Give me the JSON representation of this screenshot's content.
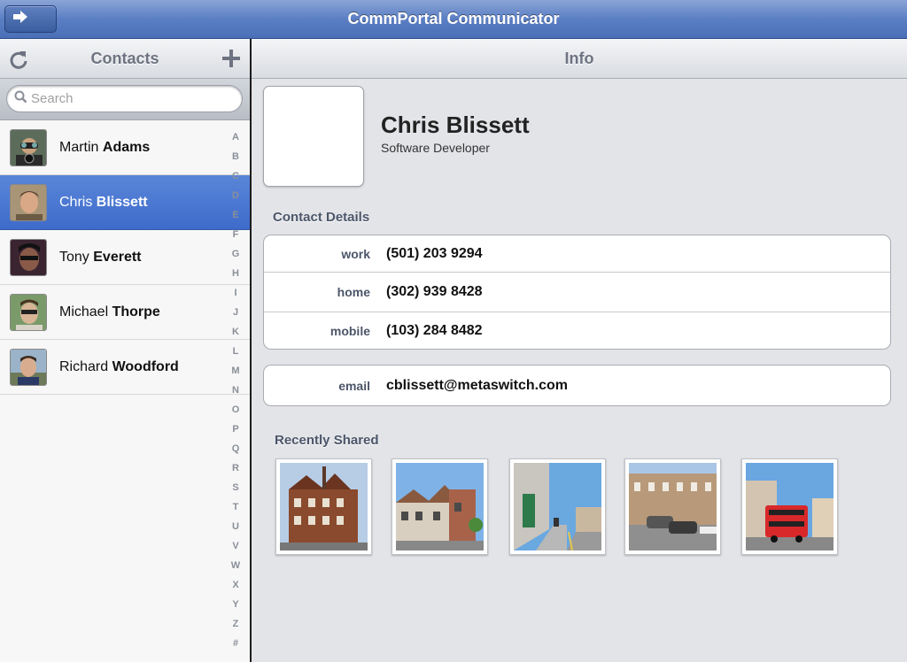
{
  "app": {
    "title": "CommPortal Communicator"
  },
  "left": {
    "header": "Contacts",
    "search_placeholder": "Search",
    "contacts": [
      {
        "first": "Martin",
        "last": "Adams",
        "selected": false
      },
      {
        "first": "Chris",
        "last": "Blissett",
        "selected": true
      },
      {
        "first": "Tony",
        "last": "Everett",
        "selected": false
      },
      {
        "first": "Michael",
        "last": "Thorpe",
        "selected": false
      },
      {
        "first": "Richard",
        "last": "Woodford",
        "selected": false
      }
    ],
    "index": [
      "A",
      "B",
      "C",
      "D",
      "E",
      "F",
      "G",
      "H",
      "I",
      "J",
      "K",
      "L",
      "M",
      "N",
      "O",
      "P",
      "Q",
      "R",
      "S",
      "T",
      "U",
      "V",
      "W",
      "X",
      "Y",
      "Z",
      "#"
    ]
  },
  "right": {
    "header": "Info",
    "name": "Chris Blissett",
    "job_title": "Software Developer",
    "details_label": "Contact Details",
    "phones": [
      {
        "label": "work",
        "value": "(501) 203 9294"
      },
      {
        "label": "home",
        "value": "(302) 939 8428"
      },
      {
        "label": "mobile",
        "value": "(103) 284 8482"
      }
    ],
    "email": {
      "label": "email",
      "value": "cblissett@metaswitch.com"
    },
    "recent_label": "Recently Shared"
  },
  "icons": {
    "back": "arrow-right-icon",
    "refresh": "refresh-icon",
    "add": "plus-icon",
    "search": "magnifier-icon"
  },
  "colors": {
    "titlebar": "#5b7fc4",
    "selected_row": "#4a77cf",
    "section_label": "#4c566a"
  }
}
